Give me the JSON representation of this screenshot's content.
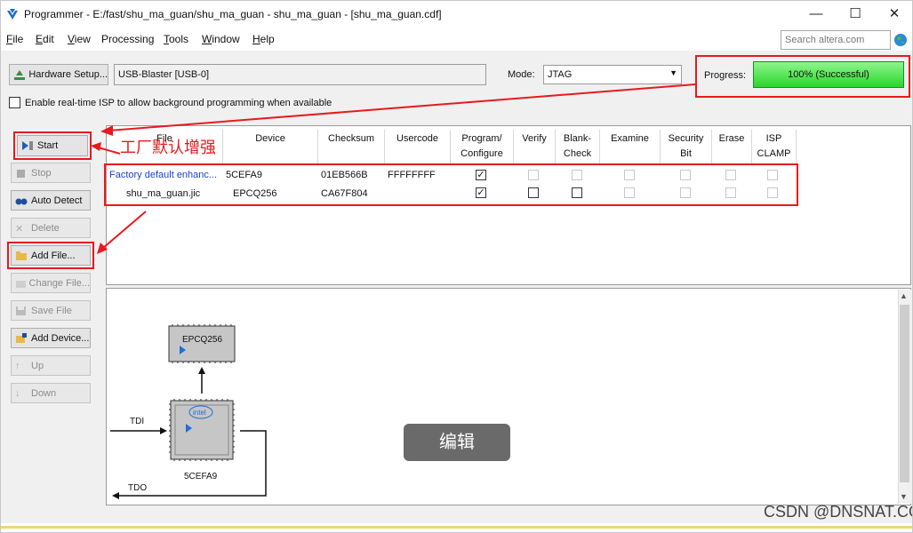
{
  "window": {
    "title": "Programmer - E:/fast/shu_ma_guan/shu_ma_guan - shu_ma_guan - [shu_ma_guan.cdf]",
    "minimize": "—",
    "maximize": "☐",
    "close": "✕"
  },
  "menu": [
    {
      "key": "F",
      "rest": "ile"
    },
    {
      "key": "E",
      "rest": "dit"
    },
    {
      "key": "V",
      "rest": "iew"
    },
    {
      "key": "",
      "rest": "Processing"
    },
    {
      "key": "T",
      "rest": "ools"
    },
    {
      "key": "W",
      "rest": "indow"
    },
    {
      "key": "H",
      "rest": "elp"
    }
  ],
  "search": {
    "placeholder": "Search altera.com"
  },
  "toolbar": {
    "hardware_setup": "Hardware Setup...",
    "hardware_value": "USB-Blaster [USB-0]",
    "mode_label": "Mode:",
    "mode_value": "JTAG",
    "progress_label": "Progress:",
    "progress_text": "100% (Successful)",
    "progress_value": 1.0,
    "isp_label": "Enable real-time ISP to allow background programming when available"
  },
  "side_buttons": {
    "start": "Start",
    "stop": "Stop",
    "auto_detect": "Auto Detect",
    "delete": "Delete",
    "add_file": "Add File...",
    "change_file": "Change File...",
    "save_file": "Save File",
    "add_device": "Add Device...",
    "up": "Up",
    "down": "Down"
  },
  "table": {
    "headers": {
      "file": "File",
      "device": "Device",
      "checksum": "Checksum",
      "usercode": "Usercode",
      "program1": "Program/",
      "program2": "Configure",
      "verify": "Verify",
      "blank1": "Blank-",
      "blank2": "Check",
      "examine": "Examine",
      "security1": "Security",
      "security2": "Bit",
      "erase": "Erase",
      "isp1": "ISP",
      "isp2": "CLAMP"
    },
    "rows": [
      {
        "file": "Factory default enhanc...",
        "device": "5CEFA9",
        "checksum": "01EB566B",
        "usercode": "FFFFFFFF",
        "program": true
      },
      {
        "file": "shu_ma_guan.jic",
        "device": "EPCQ256",
        "checksum": "CA67F804",
        "usercode": "",
        "program": true
      }
    ]
  },
  "diagram": {
    "chip_top": "EPCQ256",
    "chip_main": "5CEFA9",
    "chip_logo": "intel",
    "tdi": "TDI",
    "tdo": "TDO"
  },
  "annotation": "工厂默认增强",
  "edit_button": "编辑",
  "watermark": "CSDN @DNSNAT.COM"
}
